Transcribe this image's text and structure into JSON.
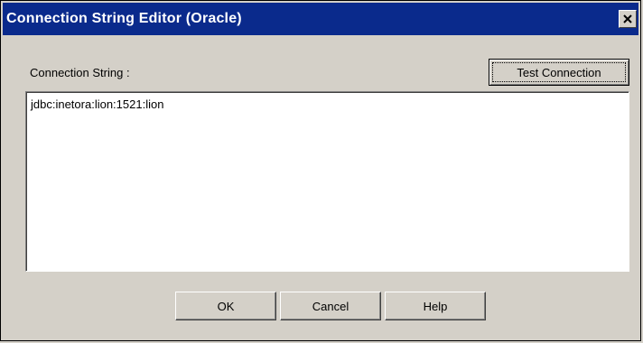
{
  "window": {
    "title": "Connection String Editor (Oracle)",
    "close_icon": "close-icon"
  },
  "editor": {
    "label": "Connection String :",
    "value": "jdbc:inetora:lion:1521:lion",
    "test_button": "Test Connection"
  },
  "footer": {
    "ok": "OK",
    "cancel": "Cancel",
    "help": "Help"
  }
}
